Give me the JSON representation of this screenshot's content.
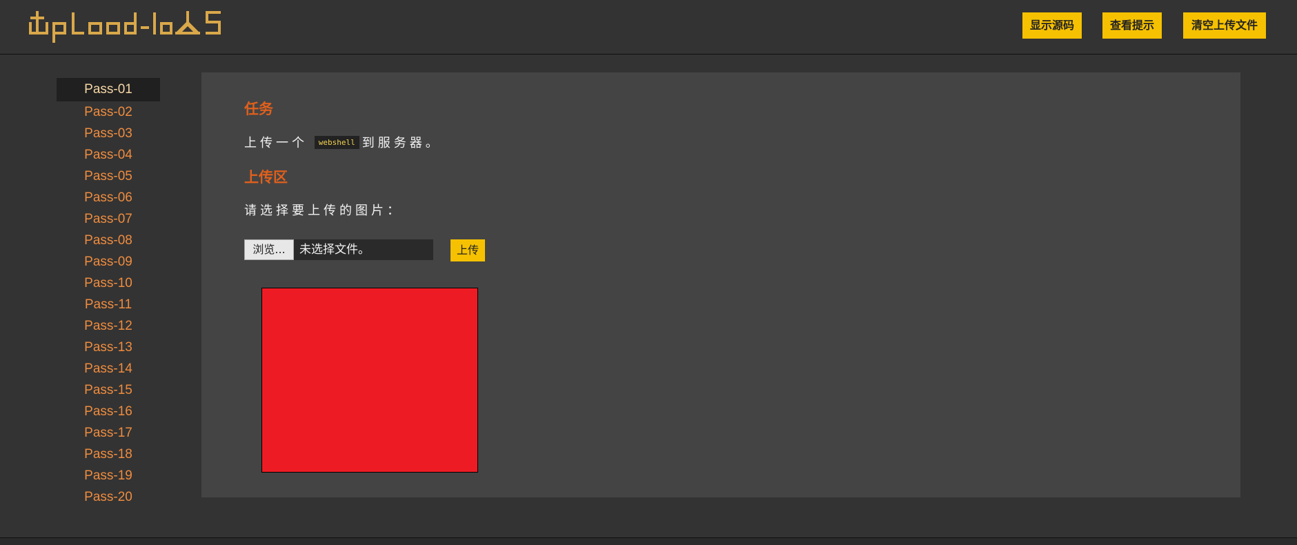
{
  "header": {
    "logo_text": "Upload-labs",
    "buttons": {
      "show_source": "显示源码",
      "view_hint": "查看提示",
      "clear_uploads": "清空上传文件"
    }
  },
  "sidebar": {
    "items": [
      {
        "label": "Pass-01",
        "active": true
      },
      {
        "label": "Pass-02"
      },
      {
        "label": "Pass-03"
      },
      {
        "label": "Pass-04"
      },
      {
        "label": "Pass-05"
      },
      {
        "label": "Pass-06"
      },
      {
        "label": "Pass-07"
      },
      {
        "label": "Pass-08"
      },
      {
        "label": "Pass-09"
      },
      {
        "label": "Pass-10"
      },
      {
        "label": "Pass-11"
      },
      {
        "label": "Pass-12"
      },
      {
        "label": "Pass-13"
      },
      {
        "label": "Pass-14"
      },
      {
        "label": "Pass-15"
      },
      {
        "label": "Pass-16"
      },
      {
        "label": "Pass-17"
      },
      {
        "label": "Pass-18"
      },
      {
        "label": "Pass-19"
      },
      {
        "label": "Pass-20"
      }
    ]
  },
  "main": {
    "task_heading": "任务",
    "task_text_before": "上传一个",
    "task_code": "webshell",
    "task_text_after": "到服务器。",
    "upload_heading": "上传区",
    "select_prompt": "请选择要上传的图片：",
    "browse_label": "浏览...",
    "file_status": "未选择文件。",
    "upload_label": "上传"
  },
  "colors": {
    "accent_yellow": "#f6c100",
    "heading_orange": "#e0601c",
    "link_orange": "#f08c3e",
    "preview_red": "#ed1c24",
    "background": "#333333",
    "panel": "#444444"
  }
}
